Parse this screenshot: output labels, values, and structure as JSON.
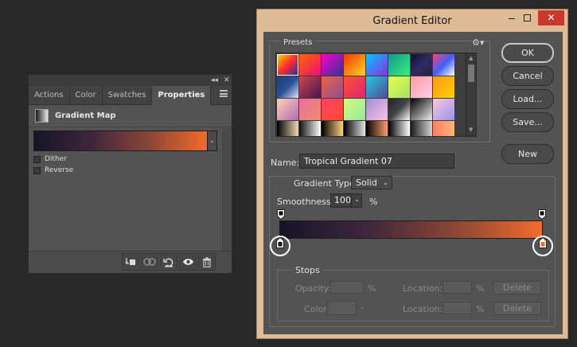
{
  "properties_panel": {
    "tabs": [
      "Actions",
      "Color",
      "Swatches",
      "Properties"
    ],
    "active_tab": "Properties",
    "collapse_glyph": "◂◂",
    "close_glyph": "✕",
    "adjustment_title": "Gradient Map",
    "dropdown_glyph": "⌄",
    "dither_label": "Dither",
    "reverse_label": "Reverse",
    "gradient_colors": [
      "#151528",
      "#40263c",
      "#8b4636",
      "#f46a2c"
    ],
    "bottom_icons": [
      "clip-to-layer-icon",
      "view-previous-state-icon",
      "reset-icon",
      "visibility-eye-icon",
      "trash-icon"
    ]
  },
  "gradient_editor": {
    "title": "Gradient Editor",
    "close_glyph": "✕",
    "presets_label": "Presets",
    "gear_glyph": "⚙▾",
    "scroll_up_glyph": "▲",
    "scroll_down_glyph": "▼",
    "buttons": {
      "ok": "OK",
      "cancel": "Cancel",
      "load": "Load...",
      "save": "Save...",
      "new": "New"
    },
    "name_label": "Name:",
    "name_value": "Tropical Gradient 07",
    "gradient_type_label": "Gradient Type:",
    "gradient_type_value": "Solid",
    "select_arrow": "⌄",
    "smoothness_label": "Smoothness:",
    "smoothness_value": "100",
    "smoothness_unit": "%",
    "stops_label": "Stops",
    "opacity_label": "Opacity:",
    "color_label": "Color:",
    "location_label": "Location:",
    "percent": "%",
    "delete_label": "Delete",
    "ramp_colors": [
      "#151528",
      "#40263c",
      "#8b4636",
      "#f46a2c"
    ],
    "left_stop_color": "#151528",
    "right_stop_color": "#f46a2c"
  }
}
